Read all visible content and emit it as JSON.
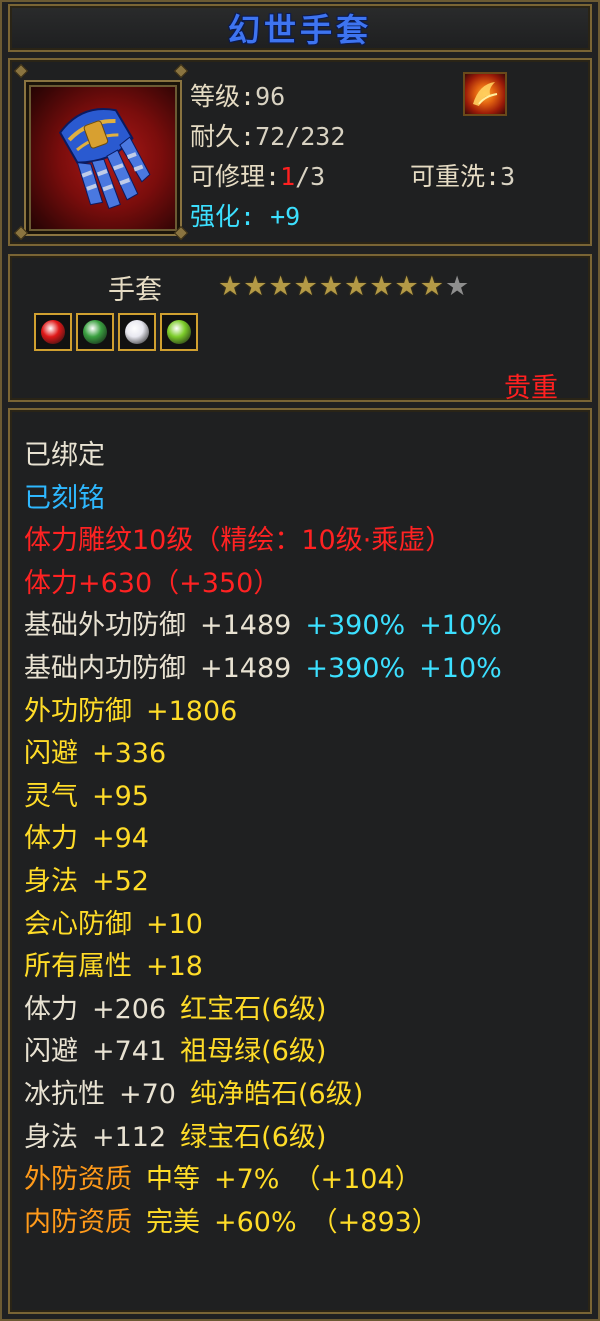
{
  "item": {
    "name": "幻世手套",
    "level_label": "等级:",
    "level": "96",
    "durability_label": "耐久:",
    "durability": "72/232",
    "repair_label": "可修理:",
    "repair_used": "1",
    "repair_total": "/3",
    "rewash_label": "可重洗:",
    "rewash": "3",
    "enhance_label": "强化:",
    "enhance": "+9",
    "type": "手套",
    "stars_filled": 9,
    "stars_total": 10,
    "rarity": "贵重",
    "icon": "gauntlet-icon",
    "emblem_icon": "flame-emblem-icon",
    "gems": [
      {
        "icon": "red-gem-icon",
        "color": "#e01818"
      },
      {
        "icon": "green-gem-icon",
        "color": "#3aa040"
      },
      {
        "icon": "white-gem-icon",
        "color": "#e8e8f0"
      },
      {
        "icon": "light-green-gem-icon",
        "color": "#7ccc2a"
      }
    ]
  },
  "attributes": [
    {
      "parts": [
        {
          "text": "已绑定",
          "color": "#e8e2d2"
        }
      ]
    },
    {
      "parts": [
        {
          "text": "已刻铭",
          "color": "#2eb8ff"
        }
      ]
    },
    {
      "parts": [
        {
          "text": "体力雕纹10级（精绘：10级·乘虚）",
          "color": "#ff2222"
        }
      ]
    },
    {
      "parts": [
        {
          "text": "体力+630（+350）",
          "color": "#ff2222"
        }
      ]
    },
    {
      "parts": [
        {
          "text": "基础外功防御",
          "color": "#e8e2d2"
        },
        {
          "text": "+1489",
          "color": "#e8e2d2"
        },
        {
          "text": "+390%",
          "color": "#3ce0ff"
        },
        {
          "text": "+10%",
          "color": "#3ce0ff"
        }
      ]
    },
    {
      "parts": [
        {
          "text": "基础内功防御",
          "color": "#e8e2d2"
        },
        {
          "text": "+1489",
          "color": "#e8e2d2"
        },
        {
          "text": "+390%",
          "color": "#3ce0ff"
        },
        {
          "text": "+10%",
          "color": "#3ce0ff"
        }
      ]
    },
    {
      "parts": [
        {
          "text": "外功防御",
          "color": "#ffdc28"
        },
        {
          "text": "+1806",
          "color": "#ffdc28"
        }
      ]
    },
    {
      "parts": [
        {
          "text": "闪避",
          "color": "#ffdc28"
        },
        {
          "text": "+336",
          "color": "#ffdc28"
        }
      ]
    },
    {
      "parts": [
        {
          "text": "灵气",
          "color": "#ffdc28"
        },
        {
          "text": "+95",
          "color": "#ffdc28"
        }
      ]
    },
    {
      "parts": [
        {
          "text": "体力",
          "color": "#ffdc28"
        },
        {
          "text": "+94",
          "color": "#ffdc28"
        }
      ]
    },
    {
      "parts": [
        {
          "text": "身法",
          "color": "#ffdc28"
        },
        {
          "text": "+52",
          "color": "#ffdc28"
        }
      ]
    },
    {
      "parts": [
        {
          "text": "会心防御",
          "color": "#ffdc28"
        },
        {
          "text": "+10",
          "color": "#ffdc28"
        }
      ]
    },
    {
      "parts": [
        {
          "text": "所有属性",
          "color": "#ffdc28"
        },
        {
          "text": "+18",
          "color": "#ffdc28"
        }
      ]
    },
    {
      "parts": [
        {
          "text": "体力",
          "color": "#e8e2d2"
        },
        {
          "text": "+206",
          "color": "#e8e2d2"
        },
        {
          "text": "红宝石(6级)",
          "color": "#ffdc28"
        }
      ]
    },
    {
      "parts": [
        {
          "text": "闪避",
          "color": "#e8e2d2"
        },
        {
          "text": "+741",
          "color": "#e8e2d2"
        },
        {
          "text": "祖母绿(6级)",
          "color": "#ffdc28"
        }
      ]
    },
    {
      "parts": [
        {
          "text": "冰抗性",
          "color": "#e8e2d2"
        },
        {
          "text": "+70",
          "color": "#e8e2d2"
        },
        {
          "text": "纯净皓石(6级)",
          "color": "#ffdc28"
        }
      ]
    },
    {
      "parts": [
        {
          "text": "身法",
          "color": "#e8e2d2"
        },
        {
          "text": "+112",
          "color": "#e8e2d2"
        },
        {
          "text": "绿宝石(6级)",
          "color": "#ffdc28"
        }
      ]
    },
    {
      "parts": [
        {
          "text": "外防资质",
          "color": "#ff9a1a"
        },
        {
          "text": "中等",
          "color": "#ffdc28"
        },
        {
          "text": "+7%",
          "color": "#ffdc28"
        },
        {
          "text": "（+104）",
          "color": "#ffdc28"
        }
      ]
    },
    {
      "parts": [
        {
          "text": "内防资质",
          "color": "#ff9a1a"
        },
        {
          "text": "完美",
          "color": "#ffdc28"
        },
        {
          "text": "+60%",
          "color": "#ffdc28"
        },
        {
          "text": "（+893）",
          "color": "#ffdc28"
        }
      ]
    }
  ]
}
